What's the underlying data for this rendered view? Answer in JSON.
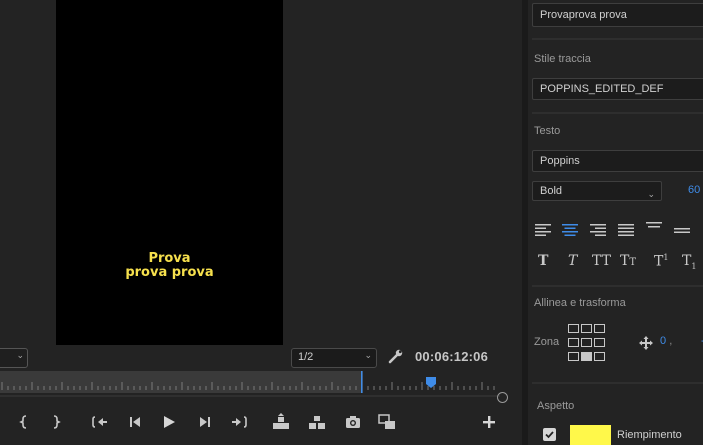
{
  "monitor": {
    "caption_line1": "Prova",
    "caption_line2": "prova prova",
    "resolution": "1/2",
    "timecode": "00:06:12:06"
  },
  "controls": {
    "icons": [
      "mark-in-icon",
      "mark-out-icon",
      "go-to-in-icon",
      "step-back-icon",
      "play-icon",
      "step-forward-icon",
      "go-to-out-icon",
      "lift-icon",
      "extract-icon",
      "export-frame-icon",
      "insert-icon",
      "add-button-icon"
    ]
  },
  "panel": {
    "text_value": "Provaprova prova",
    "track_style_label": "Stile traccia",
    "track_style_value": "POPPINS_EDITED_DEF",
    "text_section_label": "Testo",
    "font_family": "Poppins",
    "font_weight": "Bold",
    "font_size": "60",
    "align_section_label": "Allinea e trasforma",
    "zone_label": "Zona",
    "pos_x": "0",
    "pos_sep": ",",
    "appearance_label": "Aspetto",
    "fill_label": "Riempimento",
    "fill_color": "#fff84a",
    "accent_color": "#3f8ce8"
  }
}
